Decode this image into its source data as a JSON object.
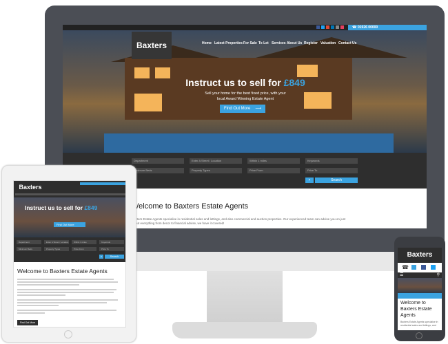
{
  "brand": "Baxters",
  "desktop": {
    "phone": "01926 00000",
    "nav": [
      "Home",
      "Latest Properties",
      "For Sale",
      "To Let",
      "Services",
      "About Us",
      "Register",
      "Valuation",
      "Contact Us"
    ],
    "hero_title_prefix": "Instruct us to sell for ",
    "hero_price": "£849",
    "hero_sub1": "Sell your home for the best fixed price, with your",
    "hero_sub2": "local Award Winning Estate Agent",
    "cta": "Find Out More",
    "search_fields": [
      "Department",
      "Enter A Street / Location",
      "Within 1 miles",
      "Keywords",
      "Minimum Beds",
      "Property Types",
      "Price From",
      "Price To"
    ],
    "search_button": "Search",
    "welcome_heading": "Welcome to Baxters Estate Agents",
    "welcome_text1": "Baxters Estate Agents specialise in residential sales and lettings, and also commercial and auction properties. Our experienced team can advise you on just",
    "welcome_text2": "about everything from decor to financial advise, we have it covered!"
  },
  "tablet": {
    "hero_title_prefix": "Instruct us to sell for ",
    "hero_price": "£849",
    "cta": "Find Out More",
    "search_fields": [
      "Department",
      "Enter A Street / Location",
      "Within 1 miles",
      "Keywords",
      "Minimum Beds",
      "Property Types",
      "Price From",
      "Price To"
    ],
    "search_button": "Search",
    "welcome_heading": "Welcome to Baxters Estate Agents",
    "cta2": "Find Out More"
  },
  "phone": {
    "welcome_heading": "Welcome to Baxters Estate Agents",
    "text": "Baxters Estate Agents specialise in residential sales and lettings, and"
  },
  "colors": {
    "accent": "#3ba3e0",
    "bezel": "#4b4e55",
    "dark": "#2e2e2e"
  }
}
